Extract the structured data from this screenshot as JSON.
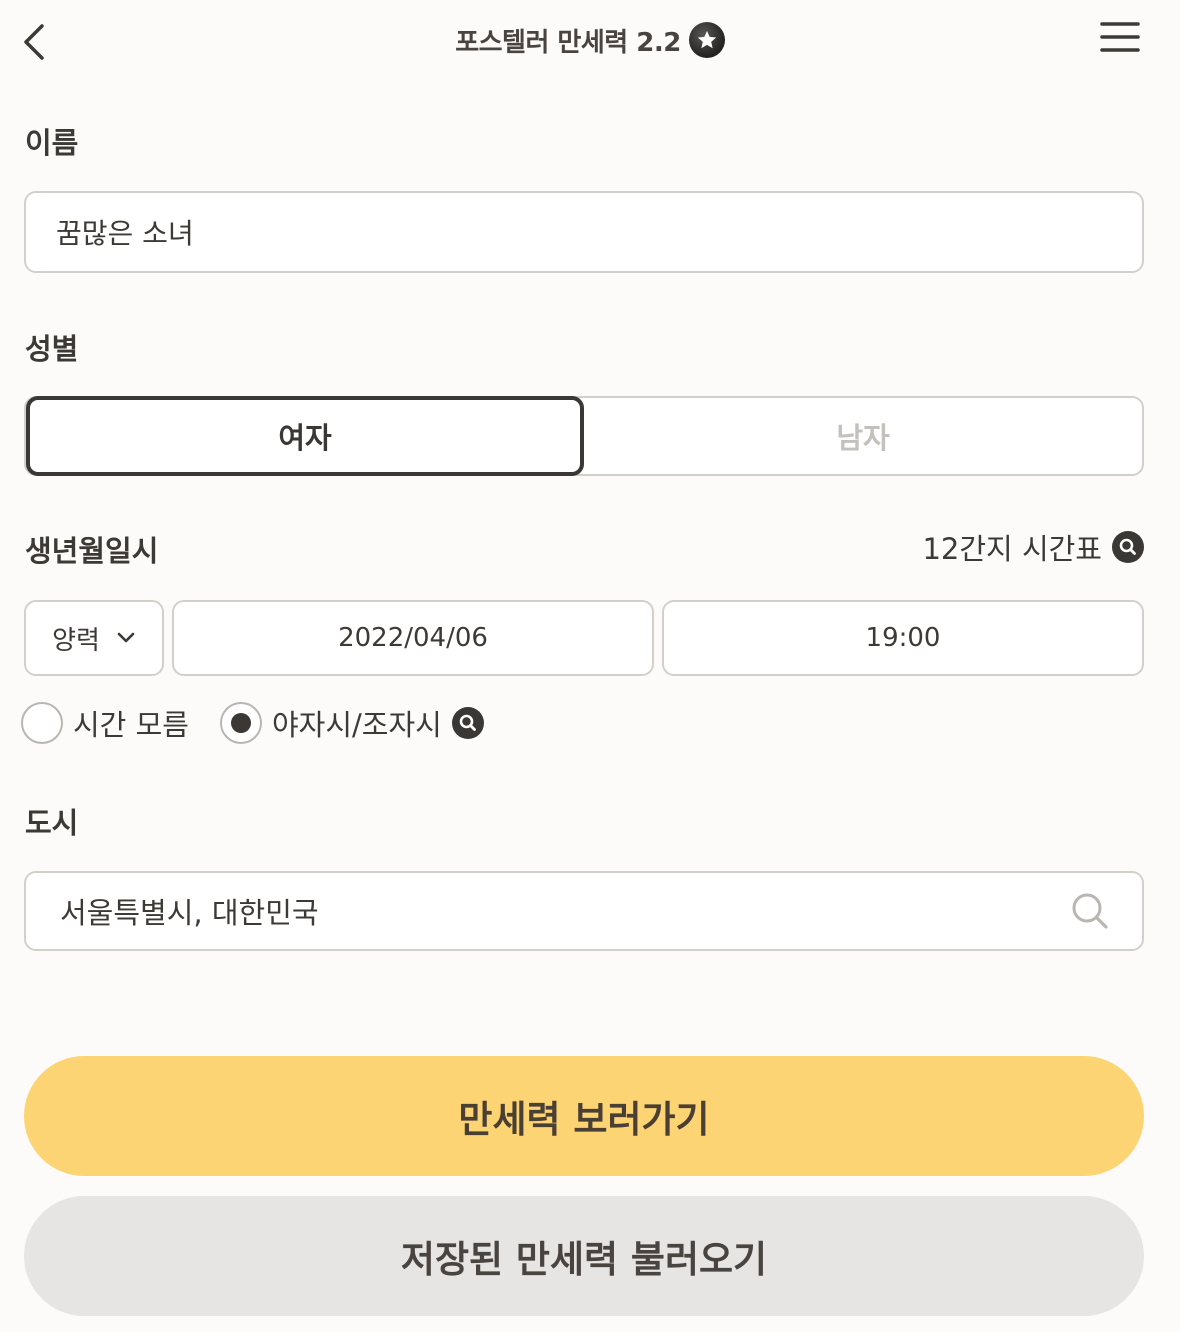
{
  "header": {
    "title": "포스텔러 만세력 2.2",
    "back_icon": "chevron-left-icon",
    "menu_icon": "hamburger-menu-icon",
    "badge_icon": "star-badge-icon"
  },
  "name": {
    "label": "이름",
    "value": "꿈많은 소녀"
  },
  "gender": {
    "label": "성별",
    "options": [
      "여자",
      "남자"
    ],
    "selected": "여자"
  },
  "birth": {
    "label": "생년월일시",
    "chart_link": "12간지 시간표",
    "calendar": "양력",
    "date": "2022/04/06",
    "time": "19:00",
    "time_unknown_label": "시간 모름",
    "time_unknown_checked": false,
    "yaja_label": "야자시/조자시",
    "yaja_checked": true
  },
  "city": {
    "label": "도시",
    "value": "서울특별시, 대한민국"
  },
  "actions": {
    "primary": "만세력 보러가기",
    "secondary": "저장된 만세력 불러오기"
  },
  "colors": {
    "background": "#fcfbf9",
    "primary_button": "#fdd474",
    "secondary_button": "#e6e5e3",
    "text": "#3d3935",
    "inactive_text": "#c4c1bd",
    "border": "#d3d0cc"
  }
}
